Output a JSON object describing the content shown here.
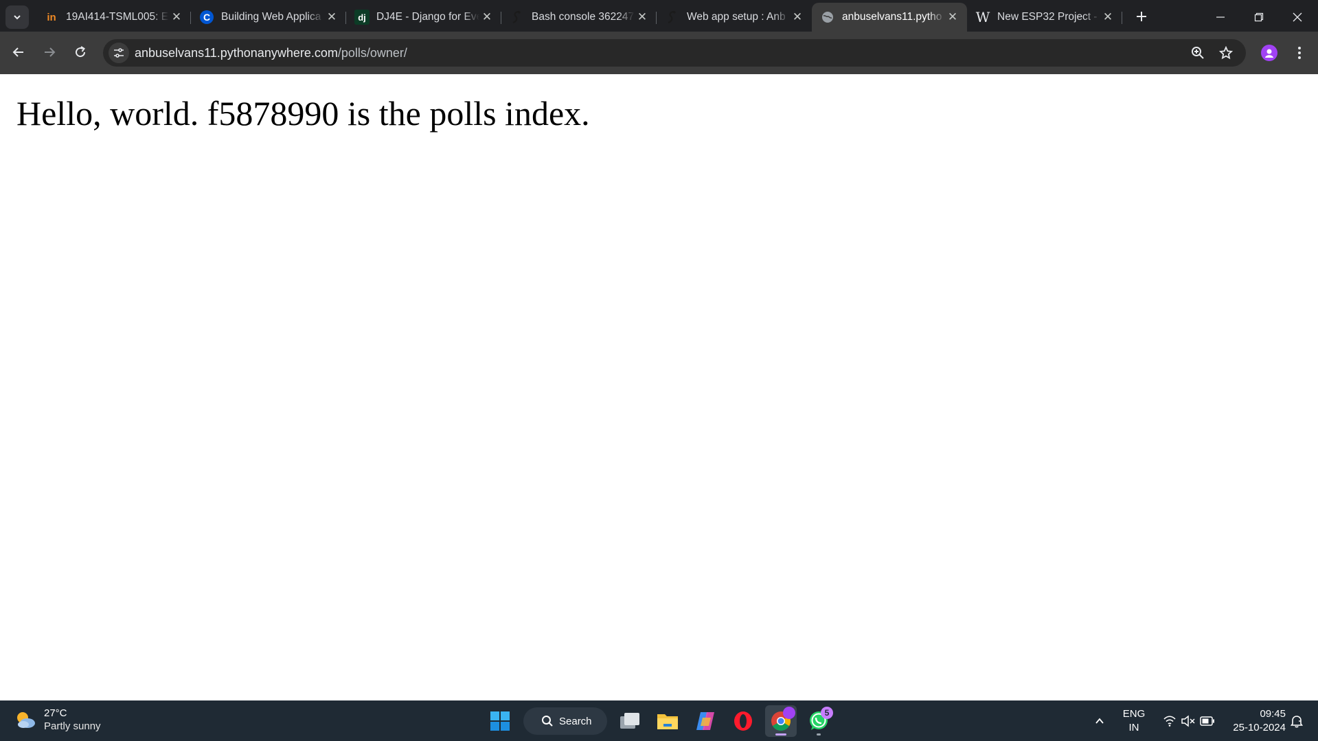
{
  "browser": {
    "tabs": [
      {
        "title": "19AI414-TSML005: Ex",
        "icon": "in-icon",
        "active": false
      },
      {
        "title": "Building Web Applica",
        "icon": "coursera-icon",
        "active": false
      },
      {
        "title": "DJ4E - Django for Eve",
        "icon": "dj-icon",
        "active": false
      },
      {
        "title": "Bash console 362247",
        "icon": "python-snake-icon",
        "active": false
      },
      {
        "title": "Web app setup : Anb",
        "icon": "python-snake-icon",
        "active": false
      },
      {
        "title": "anbuselvans11.pytho",
        "icon": "globe-icon",
        "active": true
      },
      {
        "title": "New ESP32 Project -",
        "icon": "wokwi-icon",
        "active": false
      }
    ],
    "favicon_text": {
      "dj": "dj",
      "c": "C",
      "in": "in",
      "w": "W"
    },
    "url_host": "anbuselvans11.pythonanywhere.com",
    "url_path": "/polls/owner/"
  },
  "page": {
    "heading": "Hello, world. f5878990 is the polls index."
  },
  "taskbar": {
    "weather_temp": "27°C",
    "weather_condition": "Partly sunny",
    "search_label": "Search",
    "whatsapp_badge": "5",
    "lang_line1": "ENG",
    "lang_line2": "IN",
    "time": "09:45",
    "date": "25-10-2024"
  },
  "colors": {
    "tabstrip_bg": "#202124",
    "toolbar_bg": "#3c3c3c",
    "omnibox_bg": "#282828",
    "taskbar_bg": "#1f2a34",
    "profile_accent": "#a142f4"
  }
}
